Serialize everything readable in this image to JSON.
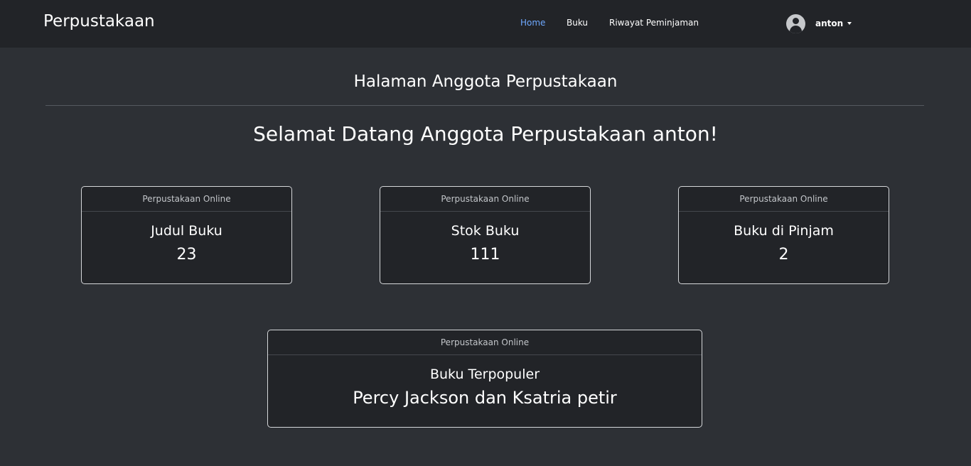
{
  "navbar": {
    "brand": "Perpustakaan",
    "links": [
      {
        "label": "Home",
        "active": true
      },
      {
        "label": "Buku",
        "active": false
      },
      {
        "label": "Riwayat Peminjaman",
        "active": false
      }
    ],
    "user": {
      "name": "anton",
      "icon": "user-circle-icon"
    }
  },
  "main": {
    "title": "Halaman Anggota Perpustakaan",
    "welcome": "Selamat Datang Anggota Perpustakaan anton!",
    "cards": [
      {
        "header": "Perpustakaan Online",
        "title": "Judul Buku",
        "value": "23"
      },
      {
        "header": "Perpustakaan Online",
        "title": "Stok Buku",
        "value": "111"
      },
      {
        "header": "Perpustakaan Online",
        "title": "Buku di Pinjam",
        "value": "2"
      }
    ],
    "popular": {
      "header": "Perpustakaan Online",
      "title": "Buku Terpopuler",
      "value": "Percy Jackson dan Ksatria petir"
    }
  },
  "colors": {
    "background": "#2d3035",
    "navbar": "#222428",
    "card": "#222428",
    "active_link": "#6ea8fe"
  }
}
